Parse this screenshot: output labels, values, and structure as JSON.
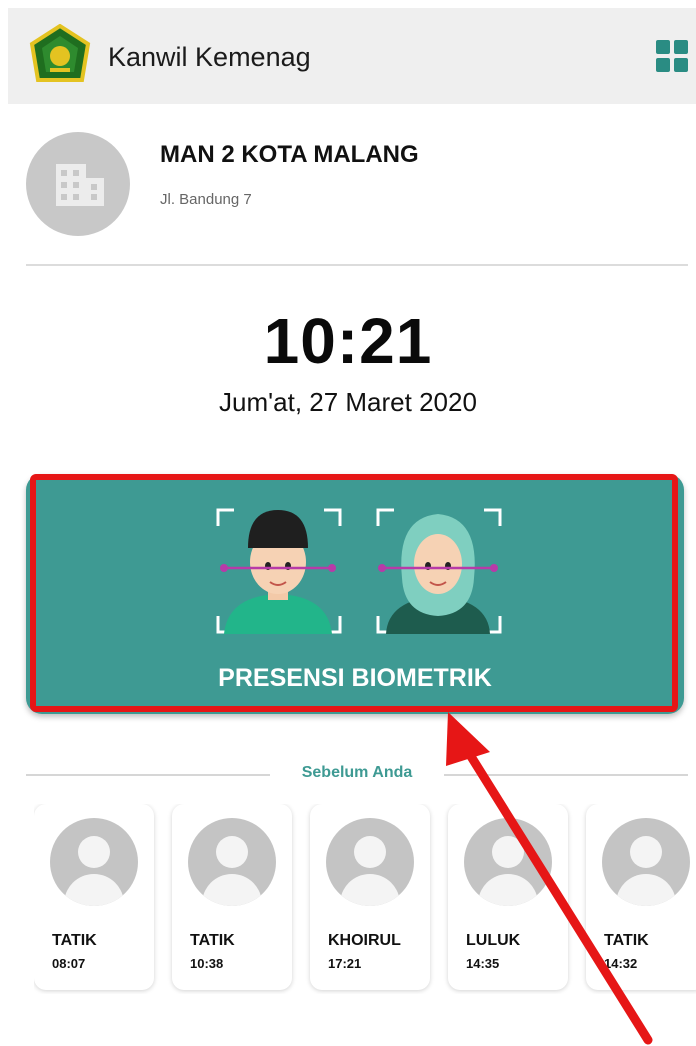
{
  "appbar": {
    "title": "Kanwil Kemenag"
  },
  "school": {
    "name": "MAN 2 KOTA MALANG",
    "address": "Jl. Bandung 7"
  },
  "clock": {
    "time": "10:21",
    "date": "Jum'at, 27 Maret 2020"
  },
  "biometric": {
    "label": "PRESENSI BIOMETRIK"
  },
  "previous": {
    "label": "Sebelum Anda",
    "people": [
      {
        "name": "TATIK",
        "time": "08:07"
      },
      {
        "name": "TATIK",
        "time": "10:38"
      },
      {
        "name": "KHOIRUL",
        "time": "17:21"
      },
      {
        "name": "LULUK",
        "time": "14:35"
      },
      {
        "name": "TATIK",
        "time": "14:32"
      }
    ]
  },
  "colors": {
    "accent": "#3e9a93",
    "highlight": "#e61616"
  }
}
